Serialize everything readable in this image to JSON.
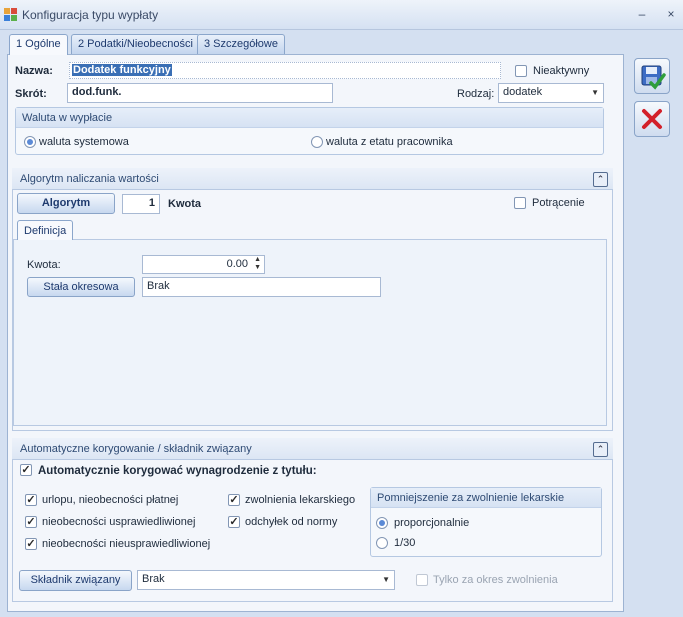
{
  "window": {
    "title": "Konfiguracja typu wypłaty",
    "min": "–",
    "close": "×"
  },
  "tabs": [
    {
      "label": "1 Ogólne"
    },
    {
      "label": "2 Podatki/Nieobecności"
    },
    {
      "label": "3 Szczegółowe"
    }
  ],
  "general": {
    "name_label": "Nazwa:",
    "name_value": "Dodatek funkcyjny",
    "inactive_label": "Nieaktywny",
    "short_label": "Skrót:",
    "short_value": "dod.funk.",
    "kind_label": "Rodzaj:",
    "kind_value": "dodatek"
  },
  "currency": {
    "title": "Waluta w wypłacie",
    "option_system": "waluta systemowa",
    "option_employment": "waluta z etatu pracownika",
    "selected": "waluta systemowa"
  },
  "algorithm": {
    "section_title": "Algorytm naliczania wartości",
    "button": "Algorytm",
    "number": "1",
    "name": "Kwota",
    "deduction_label": "Potrącenie",
    "definition_tab": "Definicja",
    "amount_label": "Kwota:",
    "amount_value": "0.00",
    "fixed_button": "Stała okresowa",
    "fixed_value": "Brak"
  },
  "correction": {
    "section_title": "Automatyczne korygowanie / składnik związany",
    "auto_label": "Automatycznie korygować wynagrodzenie z tytułu:",
    "checks": [
      {
        "label": "urlopu, nieobecności płatnej"
      },
      {
        "label": "nieobecności usprawiedliwionej"
      },
      {
        "label": "nieobecności nieusprawiedliwionej"
      },
      {
        "label": "zwolnienia lekarskiego"
      },
      {
        "label": "odchyłek od normy"
      }
    ],
    "reduction_title": "Pomniejszenie za zwolnienie lekarskie",
    "reduction_options": [
      {
        "label": "proporcjonalnie"
      },
      {
        "label": "1/30"
      }
    ],
    "linked_button": "Składnik związany",
    "linked_value": "Brak",
    "only_sick_label": "Tylko za okres zwolnienia"
  }
}
